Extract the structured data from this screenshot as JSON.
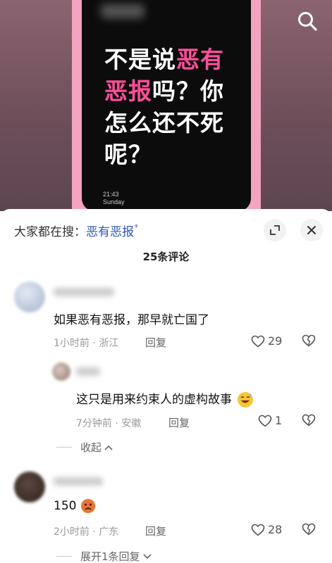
{
  "video": {
    "quote_line1_white": "不是说",
    "quote_line1_pink": "恶有",
    "quote_line2_pink": "恶报",
    "quote_line2_white": "吗？你",
    "quote_line3": "怎么还不死",
    "quote_line4": "呢？",
    "clock_time": "21:43",
    "clock_day": "Sunday",
    "search_icon": "search-icon"
  },
  "sheet": {
    "search_prefix": "大家都在搜：",
    "search_term": "恶有恶报",
    "search_marker": "ᵠ",
    "comment_count": "25条评论",
    "expand_icon": "expand-icon",
    "close_icon": "close-icon"
  },
  "comments": [
    {
      "text": "如果恶有恶报，那早就亡国了",
      "meta": "1小时前 · 浙江",
      "reply_label": "回复",
      "likes": "29"
    },
    {
      "text": "这只是用来约束人的虚构故事",
      "emoji": "grinning-sweat-emoji",
      "meta": "7分钟前 · 安徽",
      "reply_label": "回复",
      "likes": "1"
    },
    {
      "text": "150",
      "emoji": "sad-face-emoji",
      "meta": "2小时前 · 广东",
      "reply_label": "回复",
      "likes": "28"
    }
  ],
  "fold": {
    "collapse_label": "收起",
    "expand_label": "展开1条回复"
  },
  "colors": {
    "accent_pink": "#ff4f9a",
    "link_blue": "#2d57b8"
  }
}
